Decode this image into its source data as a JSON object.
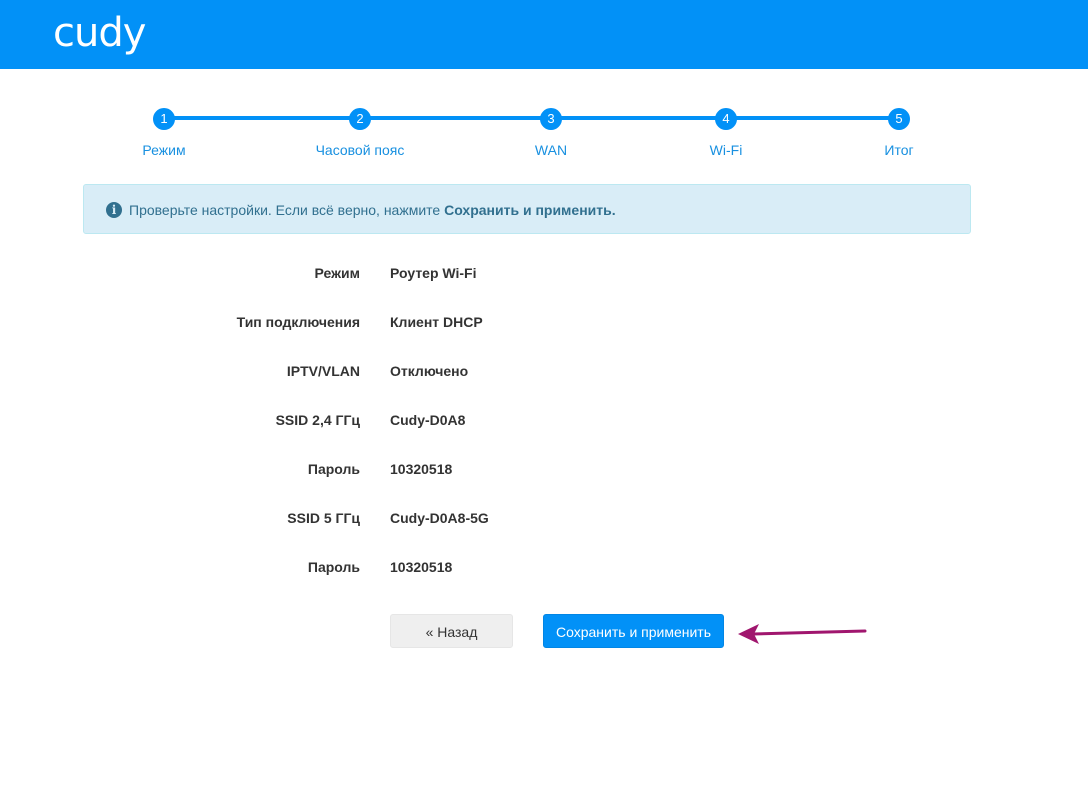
{
  "header": {
    "logo_text": "cudy",
    "brand_color": "#0291f7"
  },
  "stepper": {
    "steps": [
      {
        "number": "1",
        "label": "Режим"
      },
      {
        "number": "2",
        "label": "Часовой пояс"
      },
      {
        "number": "3",
        "label": "WAN"
      },
      {
        "number": "4",
        "label": "Wi-Fi"
      },
      {
        "number": "5",
        "label": "Итог"
      }
    ],
    "current_step": 5
  },
  "alert": {
    "icon": "info-icon",
    "text": "Проверьте настройки. Если всё верно, нажмите ",
    "emphasis": "Сохранить и применить."
  },
  "summary": {
    "rows": [
      {
        "label": "Режим",
        "value": "Роутер Wi-Fi"
      },
      {
        "label": "Тип подключения",
        "value": "Клиент DHCP"
      },
      {
        "label": "IPTV/VLAN",
        "value": "Отключено"
      },
      {
        "label": "SSID 2,4 ГГц",
        "value": "Cudy-D0A8"
      },
      {
        "label": "Пароль",
        "value": "10320518"
      },
      {
        "label": "SSID 5 ГГц",
        "value": "Cudy-D0A8-5G"
      },
      {
        "label": "Пароль",
        "value": "10320518"
      }
    ]
  },
  "actions": {
    "back_label": "« Назад",
    "save_label": "Сохранить и применить"
  },
  "annotation": {
    "arrow_color": "#a0166e"
  }
}
